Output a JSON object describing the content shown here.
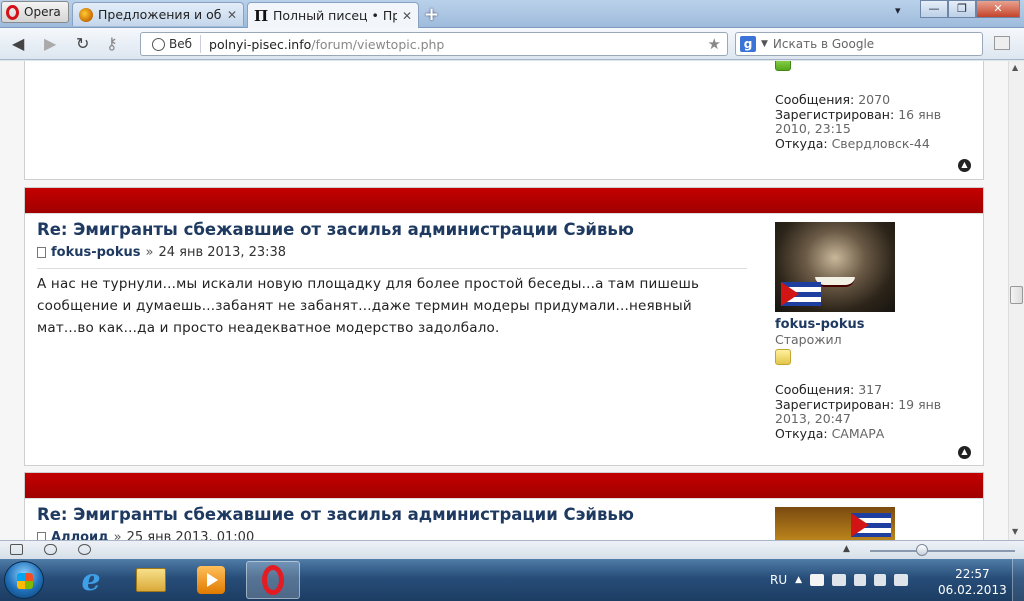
{
  "browser": {
    "menu_label": "Opera",
    "tabs": [
      {
        "title": "Предложения и обсуждения",
        "display": "Предложения и обсу..."
      },
      {
        "title": "Полный писец • Просмотр темы",
        "display": "Полный писец • Прос..."
      }
    ],
    "close_glyph": "✕",
    "new_tab_glyph": "+",
    "window_controls": [
      "—",
      "❐",
      "✕"
    ],
    "tab_menu_glyph": "▾"
  },
  "addressbar": {
    "web_label": "Веб",
    "url_host": "polnyi-pisec.info",
    "url_path": "/forum/viewtopic.php",
    "search_placeholder": "Искать в Google",
    "search_engine_letter": "g"
  },
  "posts": [
    {
      "profile": {
        "posts_label": "Сообщения:",
        "posts_value": "2070",
        "registered_label": "Зарегистрирован:",
        "registered_value": "16 янв 2010, 23:15",
        "from_label": "Откуда:",
        "from_value": "Свердловск-44",
        "rank_color": "#56a81d"
      }
    },
    {
      "title": "Re: Эмигранты сбежавшие от засилья администрации Сэйвью",
      "author": "fokus-pokus",
      "separator": "»",
      "date": "24 янв 2013, 23:38",
      "body": "А нас не турнули...мы искали новую площадку для более простой беседы...а там пишешь сообщение и думаешь...забанят не забанят...даже термин модеры придумали...неявный мат...во как...да и просто неадекватное модерство задолбало.",
      "profile": {
        "username": "fokus-pokus",
        "rank": "Старожил",
        "posts_label": "Сообщения:",
        "posts_value": "317",
        "registered_label": "Зарегистрирован:",
        "registered_value": "19 янв 2013, 20:47",
        "from_label": "Откуда:",
        "from_value": "САМАРА",
        "rank_color": "#e2c64a"
      }
    },
    {
      "title": "Re: Эмигранты сбежавшие от засилья администрации Сэйвью",
      "author": "Аллоид",
      "separator": "»",
      "date": "25 янв 2013, 01:00"
    }
  ],
  "taskbar": {
    "language": "RU",
    "time": "22:57",
    "date": "06.02.2013"
  }
}
